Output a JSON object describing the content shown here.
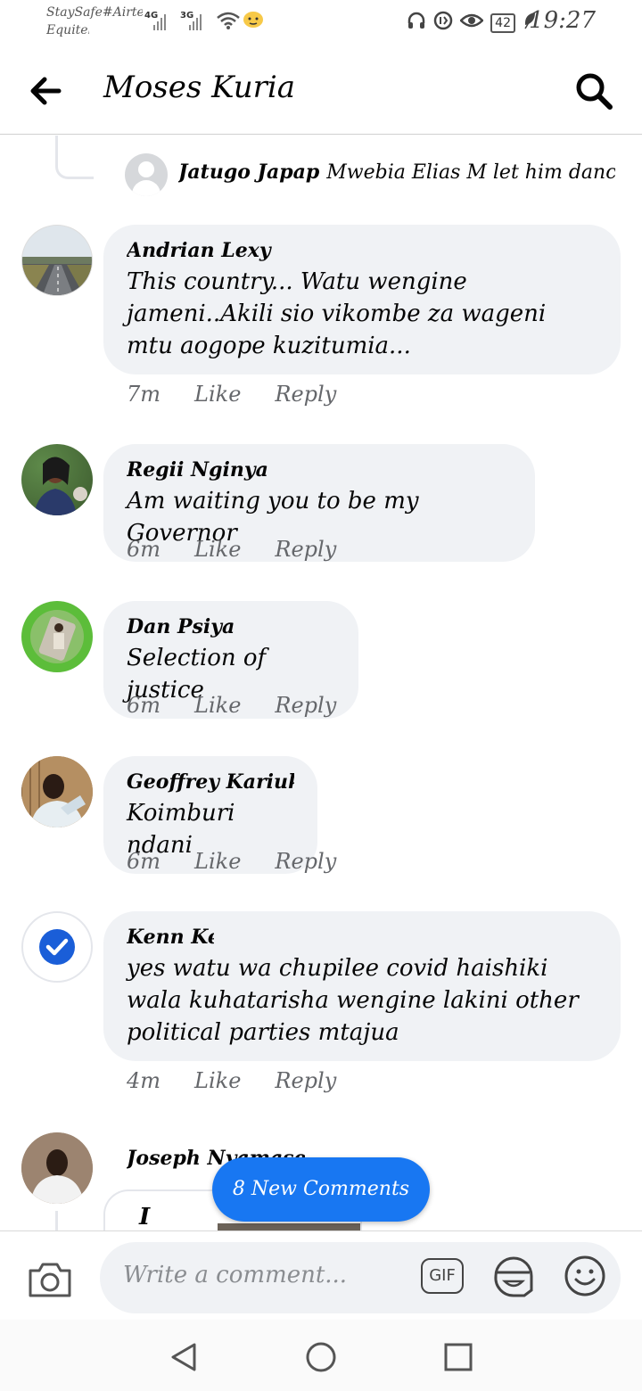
{
  "status_bar": {
    "carrier_line1": "StaySafe#Airtel",
    "carrier_line2": "Equitel",
    "network1": "4G",
    "network2": "3G",
    "battery": "42",
    "time": "19:27"
  },
  "header": {
    "title": "Moses Kuria"
  },
  "reply_preview": {
    "author": "Jatugo Japap",
    "text": "Mwebia Elias M let him dance th..."
  },
  "comments": [
    {
      "author": "Andrian Lexy",
      "text": "This country... Watu wengine jameni..Akili sio vikombe za wageni mtu aogope kuzitumia...",
      "time": "7m",
      "like": "Like",
      "reply": "Reply"
    },
    {
      "author": "Regii Nginya",
      "text": "Am waiting you to be my Governor",
      "time": "6m",
      "like": "Like",
      "reply": "Reply"
    },
    {
      "author": "Dan Psiya",
      "text": "Selection of justice",
      "time": "6m",
      "like": "Like",
      "reply": "Reply"
    },
    {
      "author": "Geoffrey Kariuki",
      "text": "Koimburi ndani",
      "time": "6m",
      "like": "Like",
      "reply": "Reply"
    },
    {
      "author": "Kenn Ken",
      "text": "yes watu wa chupilee covid haishiki wala kuhatarisha wengine lakini other political parties mtajua",
      "time": "4m",
      "like": "Like",
      "reply": "Reply"
    },
    {
      "author": "Joseph Nyamaseqe",
      "text": "I"
    }
  ],
  "new_comments_pill": "8 New Comments",
  "composer": {
    "placeholder": "Write a comment...",
    "gif_label": "GIF"
  },
  "colors": {
    "accent": "#1877f2",
    "bubble": "#f0f2f5",
    "meta": "#65676b"
  }
}
